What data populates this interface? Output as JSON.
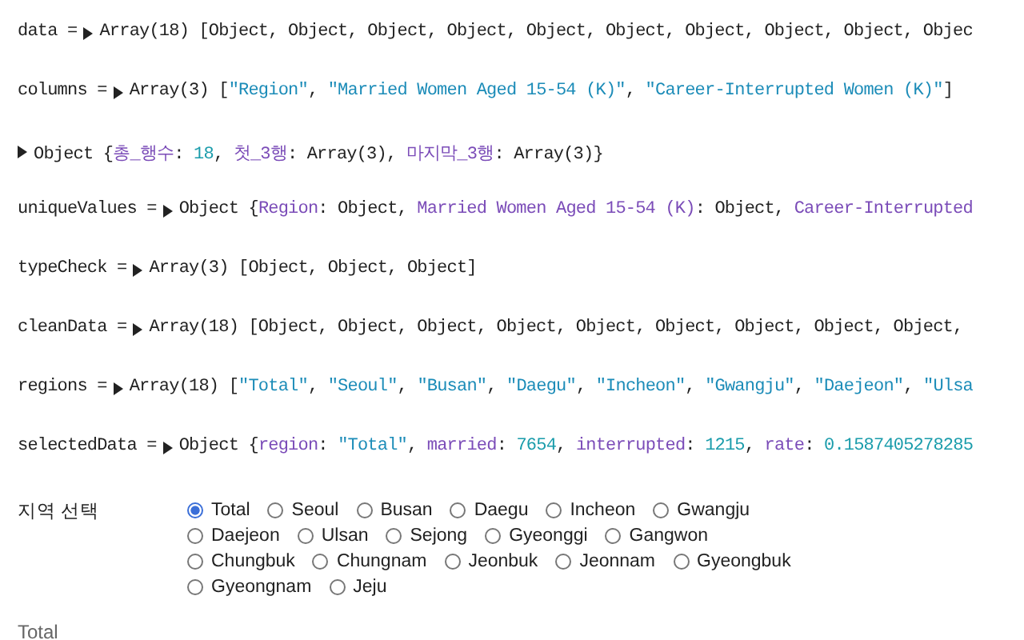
{
  "cells": [
    {
      "name": "data =",
      "tokens": [
        {
          "kind": "plain",
          "text": "Array(18) [Object, Object, Object, Object, Object, Object, Object, Object, Object, Objec"
        }
      ]
    },
    {
      "name": "columns =",
      "tokens": [
        {
          "kind": "plain",
          "text": "Array(3) ["
        },
        {
          "kind": "string",
          "text": "\"Region\""
        },
        {
          "kind": "plain",
          "text": ", "
        },
        {
          "kind": "string",
          "text": "\"Married Women Aged 15-54 (K)\""
        },
        {
          "kind": "plain",
          "text": ", "
        },
        {
          "kind": "string",
          "text": "\"Career-Interrupted Women (K)\""
        },
        {
          "kind": "plain",
          "text": "]"
        }
      ]
    },
    {
      "tokens": [
        {
          "kind": "plain",
          "text": "Object {"
        },
        {
          "kind": "key",
          "text": "총_행수"
        },
        {
          "kind": "plain",
          "text": ": "
        },
        {
          "kind": "number",
          "text": "18"
        },
        {
          "kind": "plain",
          "text": ", "
        },
        {
          "kind": "key",
          "text": "첫_3행"
        },
        {
          "kind": "plain",
          "text": ": Array(3), "
        },
        {
          "kind": "key",
          "text": "마지막_3행"
        },
        {
          "kind": "plain",
          "text": ": Array(3)}"
        }
      ]
    },
    {
      "name": "uniqueValues =",
      "tokens": [
        {
          "kind": "plain",
          "text": "Object {"
        },
        {
          "kind": "key",
          "text": "Region"
        },
        {
          "kind": "plain",
          "text": ": Object, "
        },
        {
          "kind": "key",
          "text": "Married Women Aged 15-54 (K)"
        },
        {
          "kind": "plain",
          "text": ": Object, "
        },
        {
          "kind": "key",
          "text": "Career-Interrupted"
        }
      ]
    },
    {
      "name": "typeCheck =",
      "tokens": [
        {
          "kind": "plain",
          "text": "Array(3) [Object, Object, Object]"
        }
      ]
    },
    {
      "name": "cleanData =",
      "tokens": [
        {
          "kind": "plain",
          "text": "Array(18) [Object, Object, Object, Object, Object, Object, Object, Object, Object,"
        }
      ]
    },
    {
      "name": "regions =",
      "tokens": [
        {
          "kind": "plain",
          "text": "Array(18) ["
        },
        {
          "kind": "string",
          "text": "\"Total\""
        },
        {
          "kind": "plain",
          "text": ", "
        },
        {
          "kind": "string",
          "text": "\"Seoul\""
        },
        {
          "kind": "plain",
          "text": ", "
        },
        {
          "kind": "string",
          "text": "\"Busan\""
        },
        {
          "kind": "plain",
          "text": ", "
        },
        {
          "kind": "string",
          "text": "\"Daegu\""
        },
        {
          "kind": "plain",
          "text": ", "
        },
        {
          "kind": "string",
          "text": "\"Incheon\""
        },
        {
          "kind": "plain",
          "text": ", "
        },
        {
          "kind": "string",
          "text": "\"Gwangju\""
        },
        {
          "kind": "plain",
          "text": ", "
        },
        {
          "kind": "string",
          "text": "\"Daejeon\""
        },
        {
          "kind": "plain",
          "text": ", "
        },
        {
          "kind": "string",
          "text": "\"Ulsa"
        }
      ]
    },
    {
      "name": "selectedData =",
      "tokens": [
        {
          "kind": "plain",
          "text": "Object {"
        },
        {
          "kind": "key",
          "text": "region"
        },
        {
          "kind": "plain",
          "text": ": "
        },
        {
          "kind": "string",
          "text": "\"Total\""
        },
        {
          "kind": "plain",
          "text": ", "
        },
        {
          "kind": "key",
          "text": "married"
        },
        {
          "kind": "plain",
          "text": ": "
        },
        {
          "kind": "number",
          "text": "7654"
        },
        {
          "kind": "plain",
          "text": ", "
        },
        {
          "kind": "key",
          "text": "interrupted"
        },
        {
          "kind": "plain",
          "text": ": "
        },
        {
          "kind": "number",
          "text": "1215"
        },
        {
          "kind": "plain",
          "text": ", "
        },
        {
          "kind": "key",
          "text": "rate"
        },
        {
          "kind": "plain",
          "text": ": "
        },
        {
          "kind": "number",
          "text": "0.1587405278285"
        }
      ]
    }
  ],
  "region_input": {
    "label": "지역 선택",
    "options": [
      {
        "label": "Total",
        "selected": true
      },
      {
        "label": "Seoul",
        "selected": false
      },
      {
        "label": "Busan",
        "selected": false
      },
      {
        "label": "Daegu",
        "selected": false
      },
      {
        "label": "Incheon",
        "selected": false
      },
      {
        "label": "Gwangju",
        "selected": false
      },
      {
        "label": "Daejeon",
        "selected": false
      },
      {
        "label": "Ulsan",
        "selected": false
      },
      {
        "label": "Sejong",
        "selected": false
      },
      {
        "label": "Gyeonggi",
        "selected": false
      },
      {
        "label": "Gangwon",
        "selected": false
      },
      {
        "label": "Chungbuk",
        "selected": false
      },
      {
        "label": "Chungnam",
        "selected": false
      },
      {
        "label": "Jeonbuk",
        "selected": false
      },
      {
        "label": "Jeonnam",
        "selected": false
      },
      {
        "label": "Gyeongbuk",
        "selected": false
      },
      {
        "label": "Gyeongnam",
        "selected": false
      },
      {
        "label": "Jeju",
        "selected": false
      }
    ]
  },
  "output": "Total"
}
